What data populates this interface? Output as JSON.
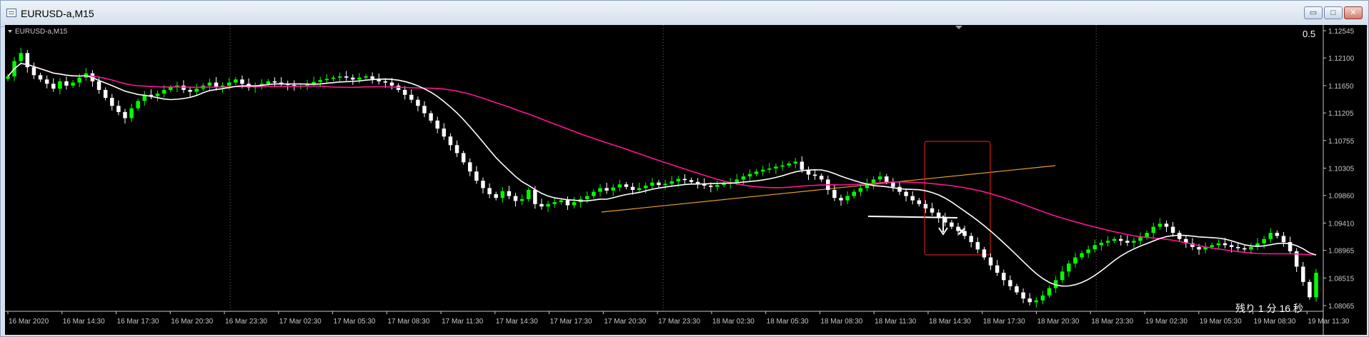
{
  "window": {
    "title": "EURUSD-a,M15",
    "buttons": {
      "minimize": "▭",
      "maximize": "□",
      "close": "✕"
    }
  },
  "chart": {
    "symbol_label": "EURUSD-a,M15",
    "spread_label": "0.5",
    "countdown_label": "残り 1 分 16 秒",
    "colors": {
      "background": "#000000",
      "grid": "#6b6b6b",
      "candle_up": "#00ff00",
      "candle_down": "#ffffff",
      "ma_fast": "#ffffff",
      "ma_slow": "#ff1493",
      "trendline": "#e6a020",
      "selection_box": "#cc1a1a"
    }
  },
  "chart_data": {
    "type": "candlestick",
    "symbol": "EURUSD-a",
    "timeframe": "M15",
    "y_ticks": [
      "1.12545",
      "1.12100",
      "1.11650",
      "1.11205",
      "1.10755",
      "1.10305",
      "1.09860",
      "1.09410",
      "1.08965",
      "1.08515",
      "1.08065"
    ],
    "ylim": [
      1.08065,
      1.12545
    ],
    "x_ticks": [
      "16 Mar 2020",
      "16 Mar 14:30",
      "16 Mar 17:30",
      "16 Mar 20:30",
      "16 Mar 23:30",
      "17 Mar 02:30",
      "17 Mar 05:30",
      "17 Mar 08:30",
      "17 Mar 11:30",
      "17 Mar 14:30",
      "17 Mar 17:30",
      "17 Mar 20:30",
      "17 Mar 23:30",
      "18 Mar 02:30",
      "18 Mar 05:30",
      "18 Mar 08:30",
      "18 Mar 11:30",
      "18 Mar 14:30",
      "18 Mar 17:30",
      "18 Mar 20:30",
      "18 Mar 23:30",
      "19 Mar 02:30",
      "19 Mar 05:30",
      "19 Mar 08:30",
      "19 Mar 11:30"
    ],
    "closes": [
      1.118,
      1.1205,
      1.1218,
      1.1195,
      1.1182,
      1.1175,
      1.1168,
      1.116,
      1.1172,
      1.1165,
      1.117,
      1.1178,
      1.1185,
      1.1172,
      1.1158,
      1.1145,
      1.1132,
      1.1122,
      1.1112,
      1.1128,
      1.114,
      1.115,
      1.1148,
      1.1152,
      1.1158,
      1.1162,
      1.1165,
      1.1158,
      1.1155,
      1.116,
      1.1165,
      1.117,
      1.1162,
      1.1165,
      1.117,
      1.1175,
      1.1168,
      1.1162,
      1.1165,
      1.1168,
      1.1172,
      1.117,
      1.1168,
      1.1166,
      1.1163,
      1.1165,
      1.1168,
      1.1171,
      1.1174,
      1.1176,
      1.1178,
      1.118,
      1.1178,
      1.1175,
      1.1178,
      1.118,
      1.1176,
      1.1172,
      1.117,
      1.1165,
      1.1158,
      1.115,
      1.1142,
      1.1132,
      1.112,
      1.1108,
      1.1095,
      1.1082,
      1.1068,
      1.1055,
      1.104,
      1.1025,
      1.101,
      1.0998,
      1.0988,
      1.0982,
      1.0993,
      1.0985,
      1.0977,
      1.098,
      1.0995,
      1.0972,
      1.0968,
      1.0972,
      1.0975,
      1.0978,
      1.097,
      1.0975,
      1.098,
      1.0985,
      1.0992,
      1.0998,
      1.0994,
      1.0999,
      1.1004,
      1.1,
      1.0995,
      1.0998,
      1.1002,
      1.1007,
      1.1003,
      1.1005,
      1.1009,
      1.1013,
      1.1011,
      1.1008,
      1.1005,
      1.1002,
      1.1,
      1.1003,
      1.1005,
      1.1008,
      1.1012,
      1.1017,
      1.1021,
      1.1025,
      1.1028,
      1.103,
      1.1033,
      1.1035,
      1.1038,
      1.1041,
      1.1028,
      1.102,
      1.1018,
      1.1012,
      1.0995,
      1.0982,
      1.0978,
      1.0985,
      1.0992,
      1.0998,
      1.1005,
      1.1012,
      1.1017,
      1.1008,
      1.1,
      1.0992,
      1.0985,
      1.0978,
      1.0972,
      1.0965,
      1.0958,
      1.095,
      1.0942,
      1.0935,
      1.0928,
      1.092,
      1.091,
      1.0898,
      1.0885,
      1.0872,
      1.086,
      1.0848,
      1.0838,
      1.0828,
      1.0818,
      1.0812,
      1.0815,
      1.0823,
      1.0835,
      1.0848,
      1.0862,
      1.0875,
      1.0885,
      1.0892,
      1.0898,
      1.0905,
      1.0909,
      1.0912,
      1.0915,
      1.0912,
      1.0909,
      1.0912,
      1.0918,
      1.0925,
      1.0935,
      1.094,
      1.0935,
      1.0925,
      1.0915,
      1.0908,
      1.0902,
      1.0898,
      1.0902,
      1.0905,
      1.0908,
      1.0905,
      1.0902,
      1.09,
      1.0898,
      1.0902,
      1.0908,
      1.0915,
      1.0925,
      1.092,
      1.091,
      1.0895,
      1.087,
      1.0845,
      1.082,
      1.086
    ]
  }
}
